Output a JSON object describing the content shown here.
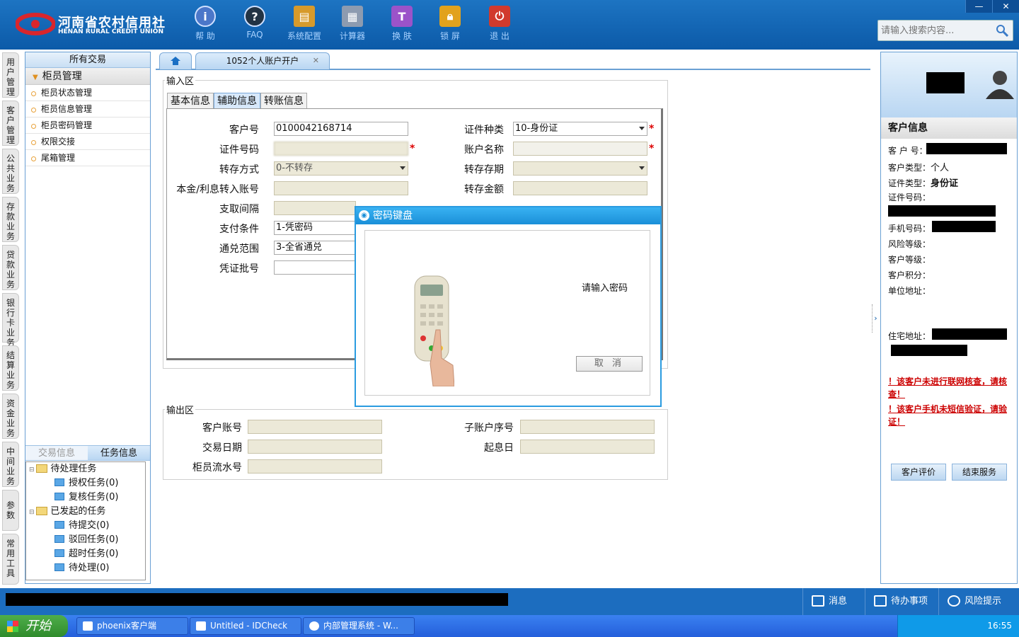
{
  "header": {
    "logo_cn": "河南省农村信用社",
    "logo_en": "HENAN RURAL CREDIT UNION",
    "toolbar": [
      {
        "label": "帮 助",
        "icon": "info-icon"
      },
      {
        "label": "FAQ",
        "icon": "question-icon"
      },
      {
        "label": "系统配置",
        "icon": "toolbox-icon"
      },
      {
        "label": "计算器",
        "icon": "calculator-icon"
      },
      {
        "label": "换 肤",
        "icon": "shirt-icon"
      },
      {
        "label": "锁 屏",
        "icon": "lock-icon"
      },
      {
        "label": "退 出",
        "icon": "power-icon"
      }
    ],
    "search_placeholder": "请输入搜索内容...",
    "window_buttons": [
      "—",
      "✕"
    ]
  },
  "vtabs": [
    "用户管理",
    "客户管理",
    "公共业务",
    "存款业务",
    "贷款业务",
    "银行卡业务",
    "结算业务",
    "资金业务",
    "中间业务",
    "参数",
    "常用工具"
  ],
  "left_panel": {
    "header": "所有交易",
    "group": "柜员管理",
    "items": [
      "柜员状态管理",
      "柜员信息管理",
      "柜员密码管理",
      "权限交接",
      "尾箱管理"
    ],
    "bottom_tabs": [
      "交易信息",
      "任务信息"
    ],
    "tree": {
      "pending": "待处理任务",
      "pending_children": [
        "授权任务(0)",
        "复核任务(0)"
      ],
      "initiated": "已发起的任务",
      "initiated_children": [
        "待提交(0)",
        "驳回任务(0)",
        "超时任务(0)",
        "待处理(0)"
      ]
    }
  },
  "tabs": {
    "active": "1052个人账户开户",
    "close": "✕"
  },
  "input_area": {
    "title": "输入区",
    "subtabs": [
      "基本信息",
      "辅助信息",
      "转账信息"
    ],
    "labels": {
      "customer_no": "客户号",
      "id_type": "证件种类",
      "id_no": "证件号码",
      "account_name": "账户名称",
      "transfer_mode": "转存方式",
      "transfer_term": "转存存期",
      "principal_account": "本金/利息转入账号",
      "transfer_amount": "转存金额",
      "withdraw_interval": "支取间隔",
      "pay_condition": "支付条件",
      "exchange_scope": "通兑范围",
      "voucher_batch": "凭证批号"
    },
    "values": {
      "customer_no": "0100042168714",
      "id_type": "10-身份证",
      "transfer_mode": "0-不转存",
      "pay_condition": "1-凭密码",
      "exchange_scope": "3-全省通兑"
    },
    "required_mark": "*"
  },
  "output_area": {
    "title": "输出区",
    "labels": {
      "customer_account": "客户账号",
      "sub_account_seq": "子账户序号",
      "trade_date": "交易日期",
      "value_date": "起息日",
      "teller_serial": "柜员流水号"
    }
  },
  "dialog": {
    "title": "密码键盘",
    "message": "请输入密码",
    "cancel": "取 消"
  },
  "right_panel": {
    "header": "客户信息",
    "rows": {
      "customer_no": "客 户 号：",
      "customer_type_label": "客户类型：",
      "customer_type": "个人",
      "id_type_label": "证件类型：",
      "id_type": "身份证",
      "id_no": "证件号码：",
      "phone": "手机号码：",
      "risk": "风险等级：",
      "level": "客户等级：",
      "points": "客户积分：",
      "work_addr": "单位地址：",
      "home_addr": "住宅地址："
    },
    "warn1": "！该客户未进行联网核查，请核查！",
    "warn2": "！该客户手机未短信验证，请验证！",
    "buttons": [
      "客户评价",
      "结束服务"
    ]
  },
  "statusbar": {
    "items": [
      "消息",
      "待办事项",
      "风险提示"
    ]
  },
  "taskbar": {
    "start": "开始",
    "windows": [
      "phoenix客户端",
      "Untitled - IDCheck",
      "内部管理系统 - W..."
    ],
    "clock": "16:55"
  }
}
